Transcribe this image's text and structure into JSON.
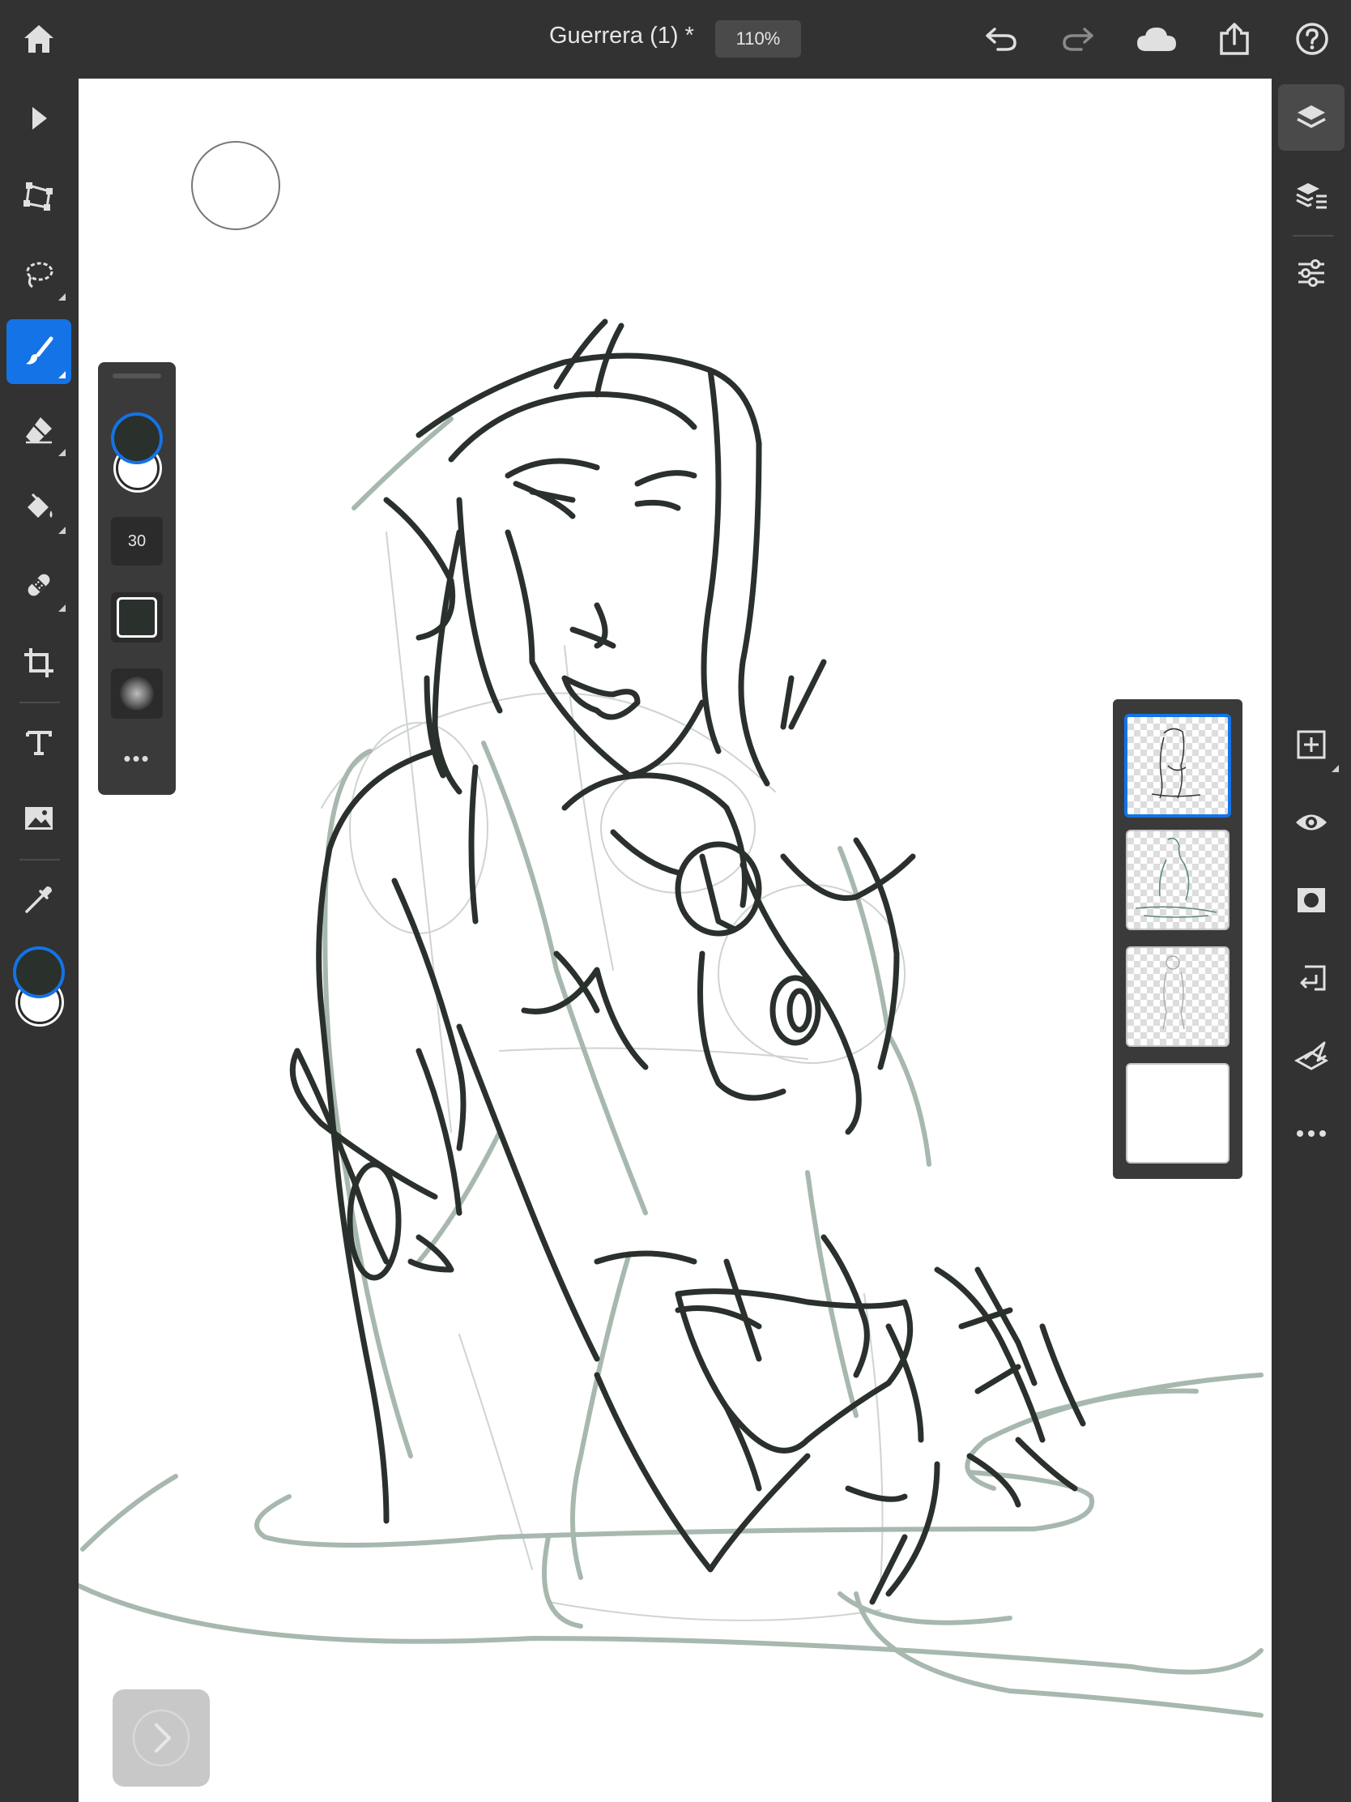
{
  "document": {
    "title": "Guerrera (1) *",
    "zoom": "110%"
  },
  "topbar": {
    "icons": [
      "home-icon",
      "undo-icon",
      "redo-icon",
      "cloud-icon",
      "share-icon",
      "help-icon"
    ]
  },
  "tools": [
    "select-icon",
    "transform-icon",
    "lasso-icon",
    "brush-icon",
    "eraser-icon",
    "fill-icon",
    "healing-icon",
    "crop-icon",
    "text-icon",
    "image-icon",
    "eyedropper-icon"
  ],
  "colors": {
    "foreground": "#2a302c",
    "background": "#ffffff",
    "accent": "#1473e6"
  },
  "brush_panel": {
    "size": "30",
    "more_label": "•••"
  },
  "layers": [
    {
      "name": "layer-1",
      "selected": true
    },
    {
      "name": "layer-2",
      "selected": false
    },
    {
      "name": "layer-3",
      "selected": false
    },
    {
      "name": "layer-4",
      "selected": false
    }
  ],
  "right_tools": [
    "layers-icon",
    "layer-properties-icon",
    "adjustments-icon",
    "add-layer-icon",
    "visibility-icon",
    "mask-icon",
    "merge-down-icon",
    "clear-layer-icon",
    "more-icon"
  ]
}
